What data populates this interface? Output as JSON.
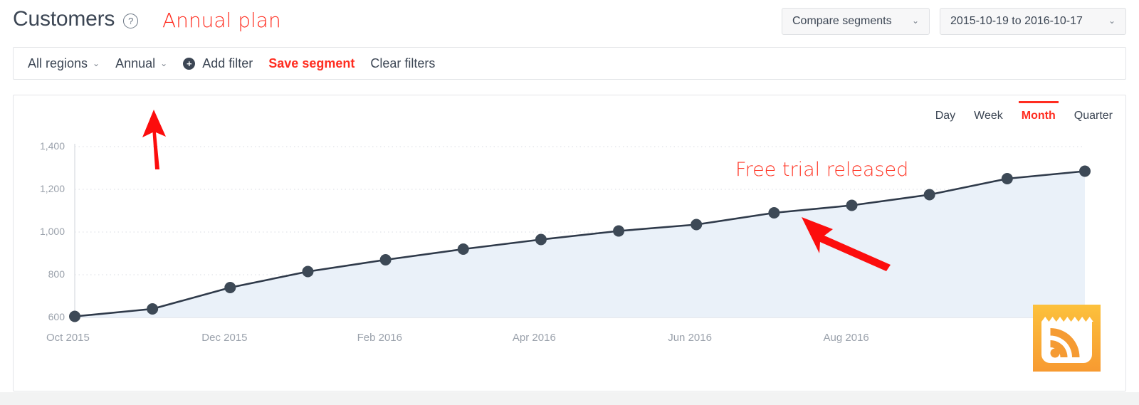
{
  "header": {
    "title": "Customers",
    "help_icon": "question-mark-circle-icon",
    "annotation": "Annual plan",
    "annotation_color": "#ff2d20",
    "compare_segments_label": "Compare segments",
    "date_range_label": "2015-10-19 to 2016-10-17",
    "caret": "⌄"
  },
  "filterbar": {
    "region_label": "All regions",
    "plan_label": "Annual",
    "add_filter_label": "Add filter",
    "save_segment_label": "Save segment",
    "clear_filters_label": "Clear filters",
    "plus_icon": "plus-circle-icon",
    "caret": "⌄"
  },
  "chart_card": {
    "granularity": [
      {
        "label": "Day",
        "active": false
      },
      {
        "label": "Week",
        "active": false
      },
      {
        "label": "Month",
        "active": true
      },
      {
        "label": "Quarter",
        "active": false
      }
    ],
    "annotation": "Free trial released",
    "annotation_color": "#ff3a2a",
    "rss_icon": "rss-feed-icon",
    "rss_color": "#f9a63a"
  },
  "chart_data": {
    "type": "line",
    "title": "Customers",
    "xlabel": "",
    "ylabel": "",
    "grid": true,
    "legend": false,
    "area_fill": true,
    "line_color": "#2f3a4a",
    "area_color": "#eaf1f9",
    "marker_color": "#3d4956",
    "ylim": [
      600,
      1400
    ],
    "ytick_labels": [
      "600",
      "800",
      "1,000",
      "1,200",
      "1,400"
    ],
    "yticks": [
      600,
      800,
      1000,
      1200,
      1400
    ],
    "xtick_labels": [
      "Oct 2015",
      "Dec 2015",
      "Feb 2016",
      "Apr 2016",
      "Jun 2016",
      "Aug 2016"
    ],
    "x": [
      "Oct 2015",
      "Nov 2015",
      "Dec 2015",
      "Jan 2016",
      "Feb 2016",
      "Mar 2016",
      "Apr 2016",
      "May 2016",
      "Jun 2016",
      "Jul 2016",
      "Aug 2016",
      "Sep 2016",
      "Oct 2016",
      "Nov 2016"
    ],
    "values": [
      605,
      640,
      740,
      815,
      870,
      920,
      965,
      1005,
      1035,
      1090,
      1125,
      1175,
      1250,
      1285
    ]
  }
}
